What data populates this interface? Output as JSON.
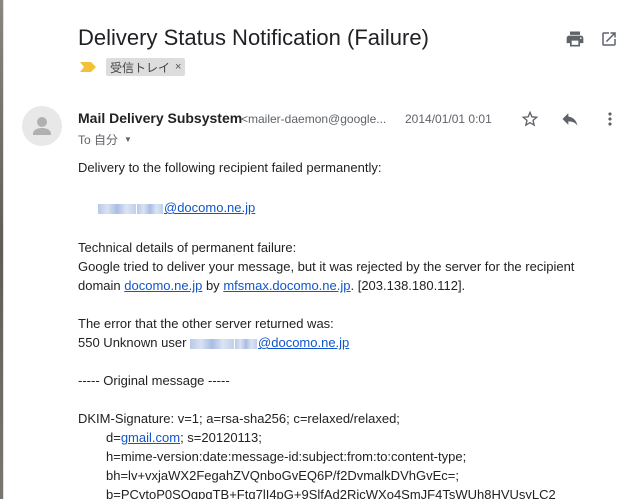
{
  "message": {
    "subject": "Delivery Status Notification (Failure)",
    "label": {
      "name": "受信トレイ",
      "remove": "×"
    },
    "sender": {
      "name": "Mail Delivery Subsystem",
      "email": "<mailer-daemon@google..."
    },
    "date": "2014/01/01 0:01",
    "to_label": "To 自分",
    "icons": {
      "print": "print-icon",
      "open_new_window": "open-in-new-window-icon",
      "star": "star-icon",
      "reply": "reply-icon",
      "more": "more-vert-icon"
    }
  },
  "body": {
    "line1": "Delivery to the following recipient failed permanently:",
    "recipient_domain": "@docomo.ne.jp",
    "tech_heading": "Technical details of permanent failure:",
    "tech_line1": "Google tried to deliver your message, but it was rejected by the server for the recipient",
    "tech_line2_prefix": "domain",
    "tech_domain_link": "docomo.ne.jp",
    "tech_by": "by",
    "tech_mx_link": "mfsmax.docomo.ne.jp",
    "tech_ip": ". [203.138.180.112].",
    "error_heading": "The error that the other server returned was:",
    "error_code": "550 Unknown user",
    "error_domain": "@docomo.ne.jp",
    "original_heading": "----- Original message -----",
    "dkim_line": "DKIM-Signature: v=1; a=rsa-sha256; c=relaxed/relaxed;",
    "d_prefix": "d=",
    "d_link": "gmail.com",
    "d_suffix": "; s=20120113;",
    "h_line": "h=mime-version:date:message-id:subject:from:to:content-type;",
    "bh_line": "bh=lv+vxjaWX2FegahZVQnboGvEQ6P/f2DvmalkDVhGvEc=;",
    "b_line": "b=PCvtoP0SQgpqTB+Ftq7lI4pG+9SlfAd2RicWXo4SmJF4TsWUh8HVUsyLC2"
  },
  "colors": {
    "link": "#1155cc",
    "label_arrow": "#f4c037",
    "icon": "#5f6368"
  }
}
